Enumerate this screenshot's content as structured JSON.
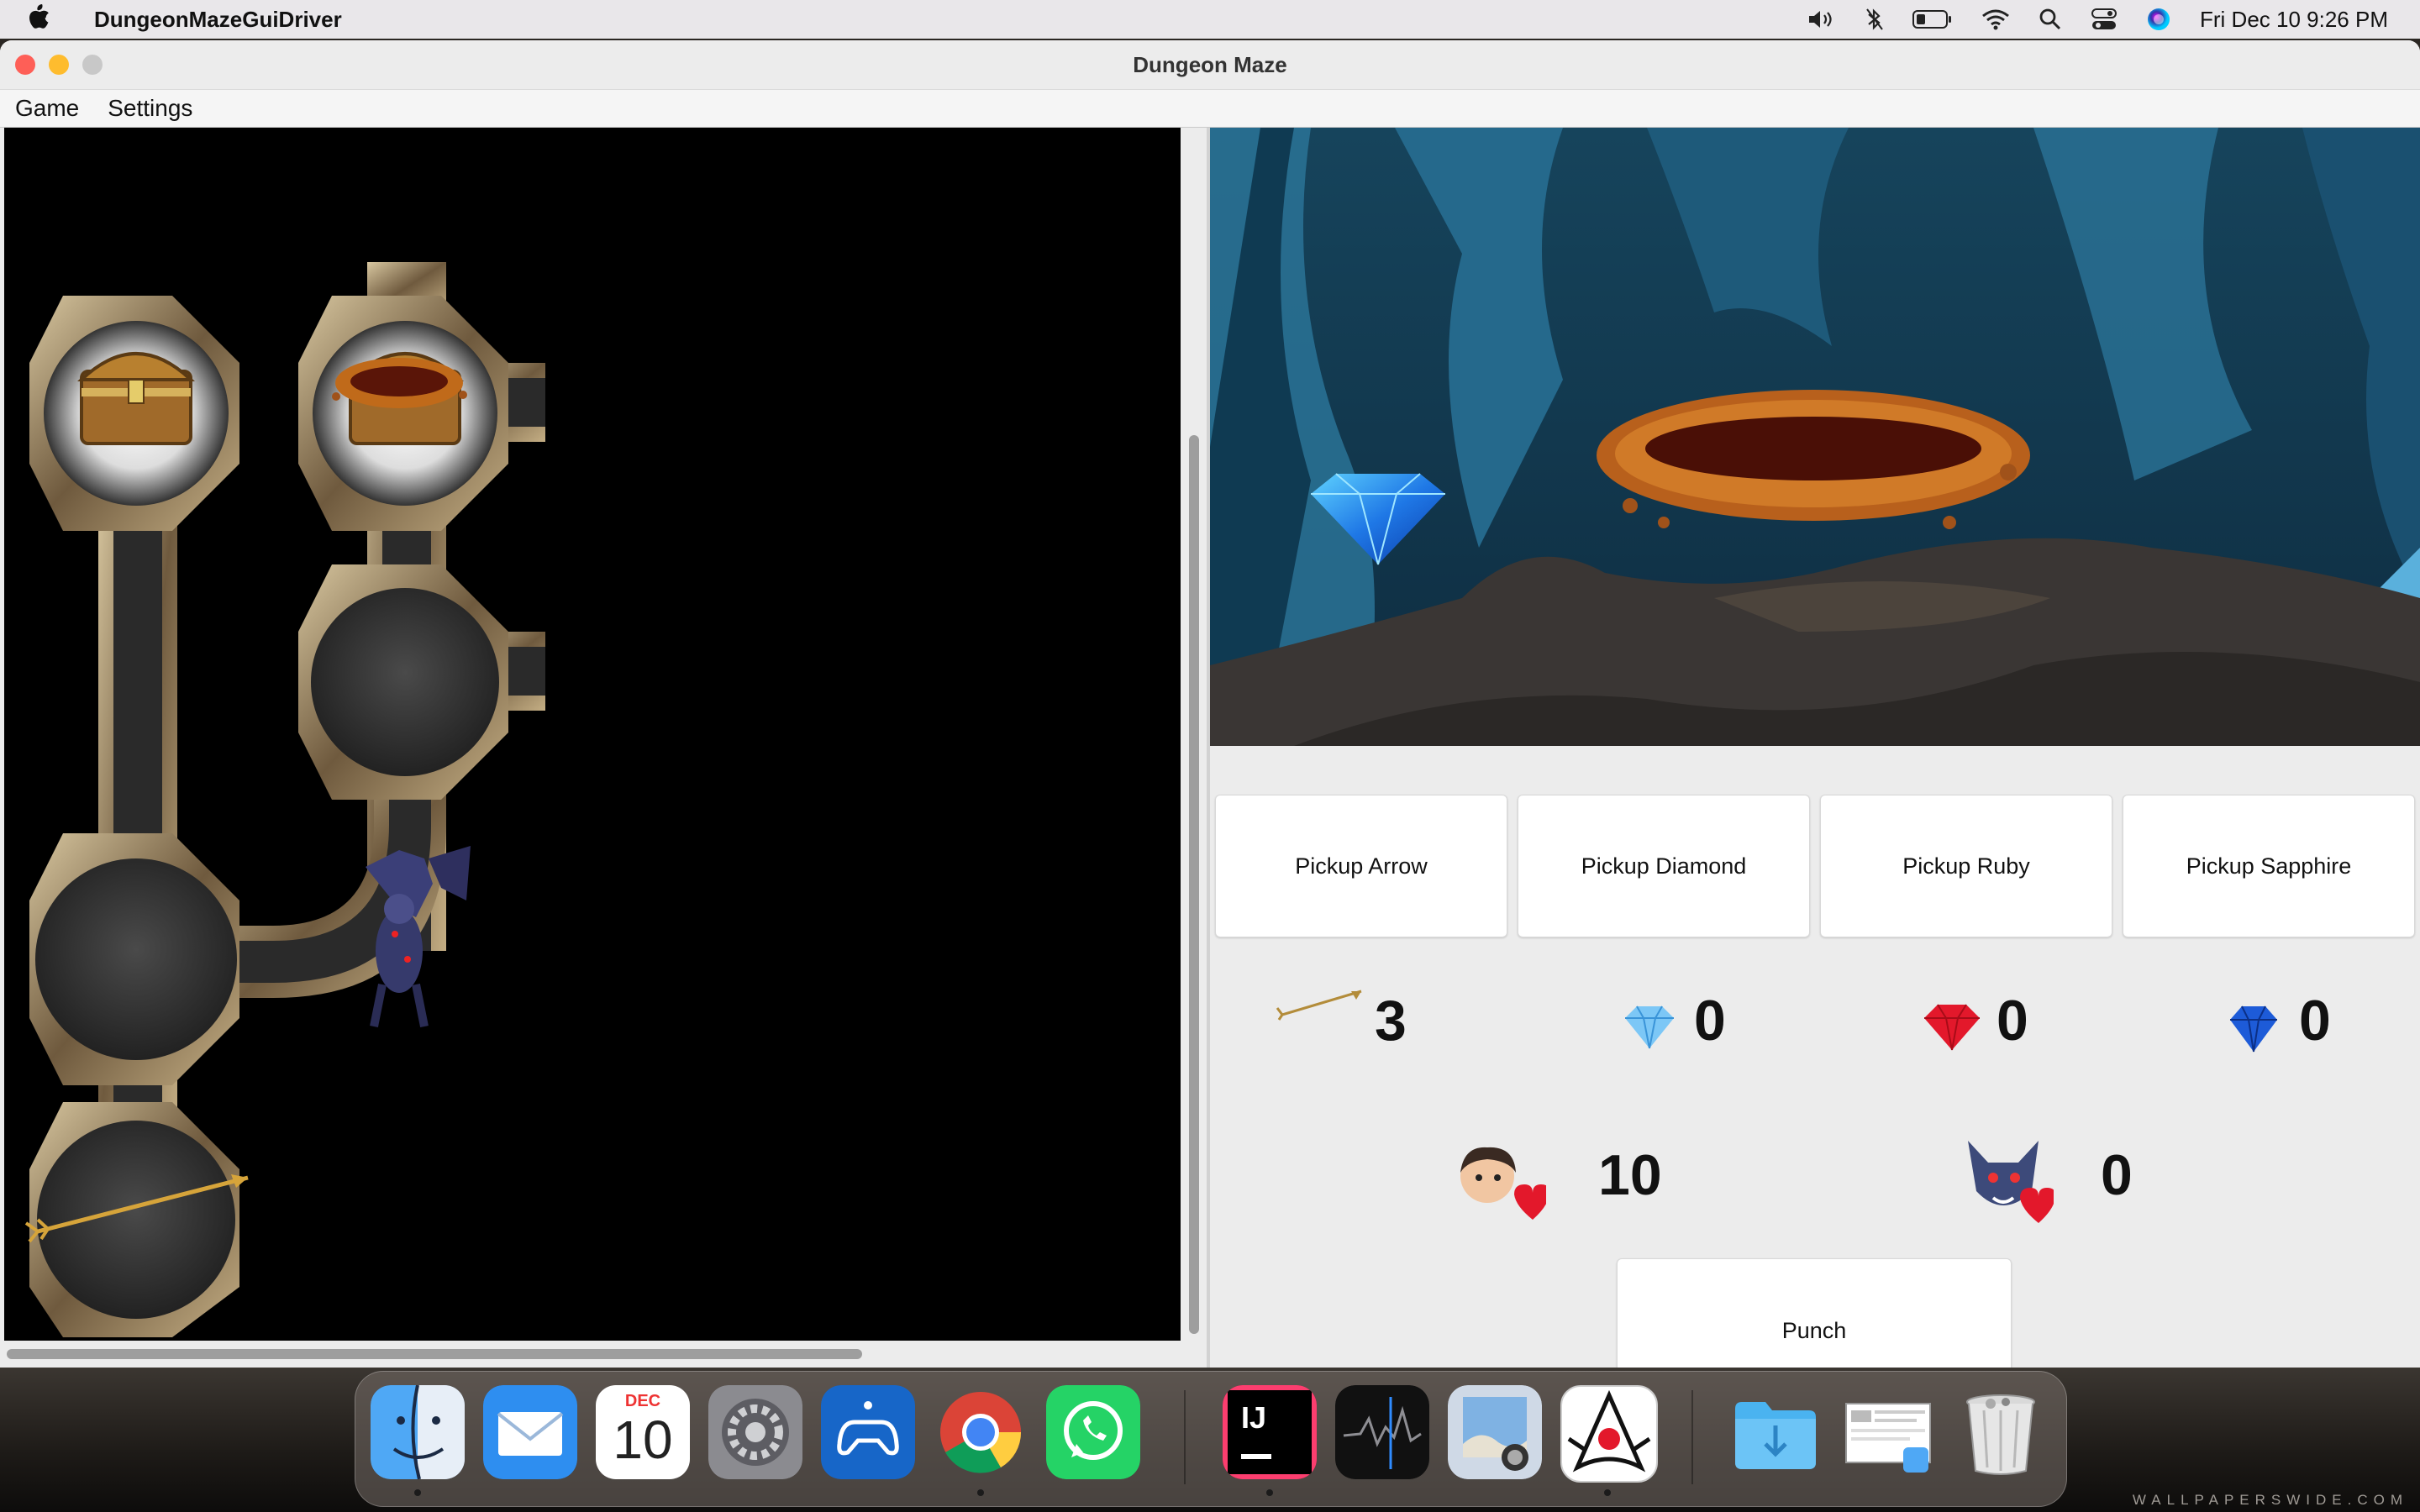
{
  "menubar": {
    "app_name": "DungeonMazeGuiDriver",
    "clock": "Fri Dec 10  9:26 PM"
  },
  "window": {
    "title": "Dungeon Maze",
    "menus": [
      "Game",
      "Settings"
    ]
  },
  "actions": {
    "pickup_arrow": "Pickup Arrow",
    "pickup_diamond": "Pickup Diamond",
    "pickup_ruby": "Pickup Ruby",
    "pickup_sapphire": "Pickup Sapphire",
    "punch": "Punch"
  },
  "inventory": {
    "arrows": "3",
    "diamonds": "0",
    "rubies": "0",
    "sapphires": "0"
  },
  "health": {
    "player": "10",
    "monster": "0"
  },
  "colors": {
    "ruby": "#e3182b",
    "sapphire": "#1d5bd8",
    "diamond": "#4aa8f0",
    "cave": "#1f5c78"
  },
  "dock": {
    "calendar_month": "DEC",
    "calendar_day": "10",
    "intellij_label": "IJ",
    "items": [
      "Finder",
      "Mail",
      "Calendar",
      "System Preferences",
      "PS Remote Play",
      "Google Chrome",
      "WhatsApp",
      "IntelliJ IDEA",
      "Stocks",
      "Preview",
      "Java",
      "Downloads",
      "Screenshot",
      "Trash"
    ]
  },
  "wallpaper_credit": "WALLPAPERSWIDE.COM"
}
